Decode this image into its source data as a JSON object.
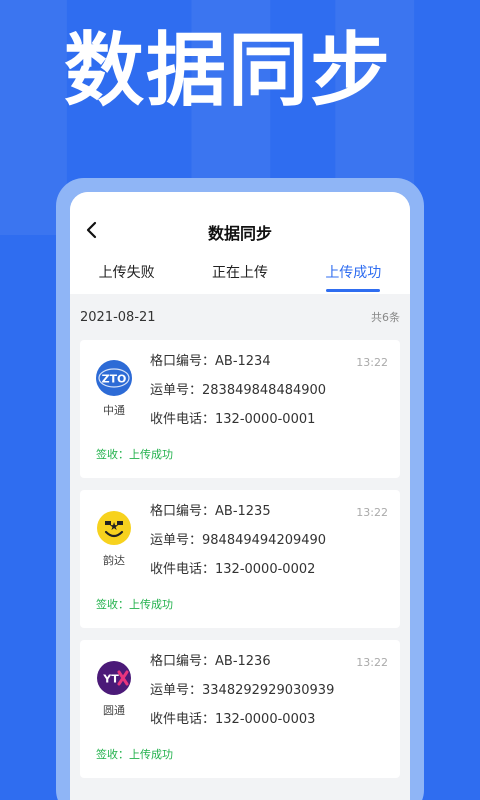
{
  "hero": {
    "title": "数据同步"
  },
  "nav": {
    "title": "数据同步"
  },
  "tabs": [
    {
      "label": "上传失败",
      "active": false
    },
    {
      "label": "正在上传",
      "active": false
    },
    {
      "label": "上传成功",
      "active": true
    }
  ],
  "list": {
    "date": "2021-08-21",
    "count": "共6条",
    "items": [
      {
        "courier": "中通",
        "logo_icon": "zto-logo-icon",
        "slot_label": "格口编号：",
        "slot": "AB-1234",
        "waybill_label": "运单号：",
        "waybill": "283849848484900",
        "phone_label": "收件电话：",
        "phone": "132-0000-0001",
        "time": "13:22",
        "status": "签收：上传成功"
      },
      {
        "courier": "韵达",
        "logo_icon": "yunda-logo-icon",
        "slot_label": "格口编号：",
        "slot": "AB-1235",
        "waybill_label": "运单号：",
        "waybill": "984849494209490",
        "phone_label": "收件电话：",
        "phone": "132-0000-0002",
        "time": "13:22",
        "status": "签收：上传成功"
      },
      {
        "courier": "圆通",
        "logo_icon": "yto-logo-icon",
        "slot_label": "格口编号：",
        "slot": "AB-1236",
        "waybill_label": "运单号：",
        "waybill": "3348292929030939",
        "phone_label": "收件电话：",
        "phone": "132-0000-0003",
        "time": "13:22",
        "status": "签收：上传成功"
      }
    ]
  },
  "colors": {
    "brand": "#2f6df0",
    "success": "#22b14c",
    "zto": "#2d6bd6",
    "yunda": "#f7d21e",
    "yto": "#4b1a78"
  }
}
